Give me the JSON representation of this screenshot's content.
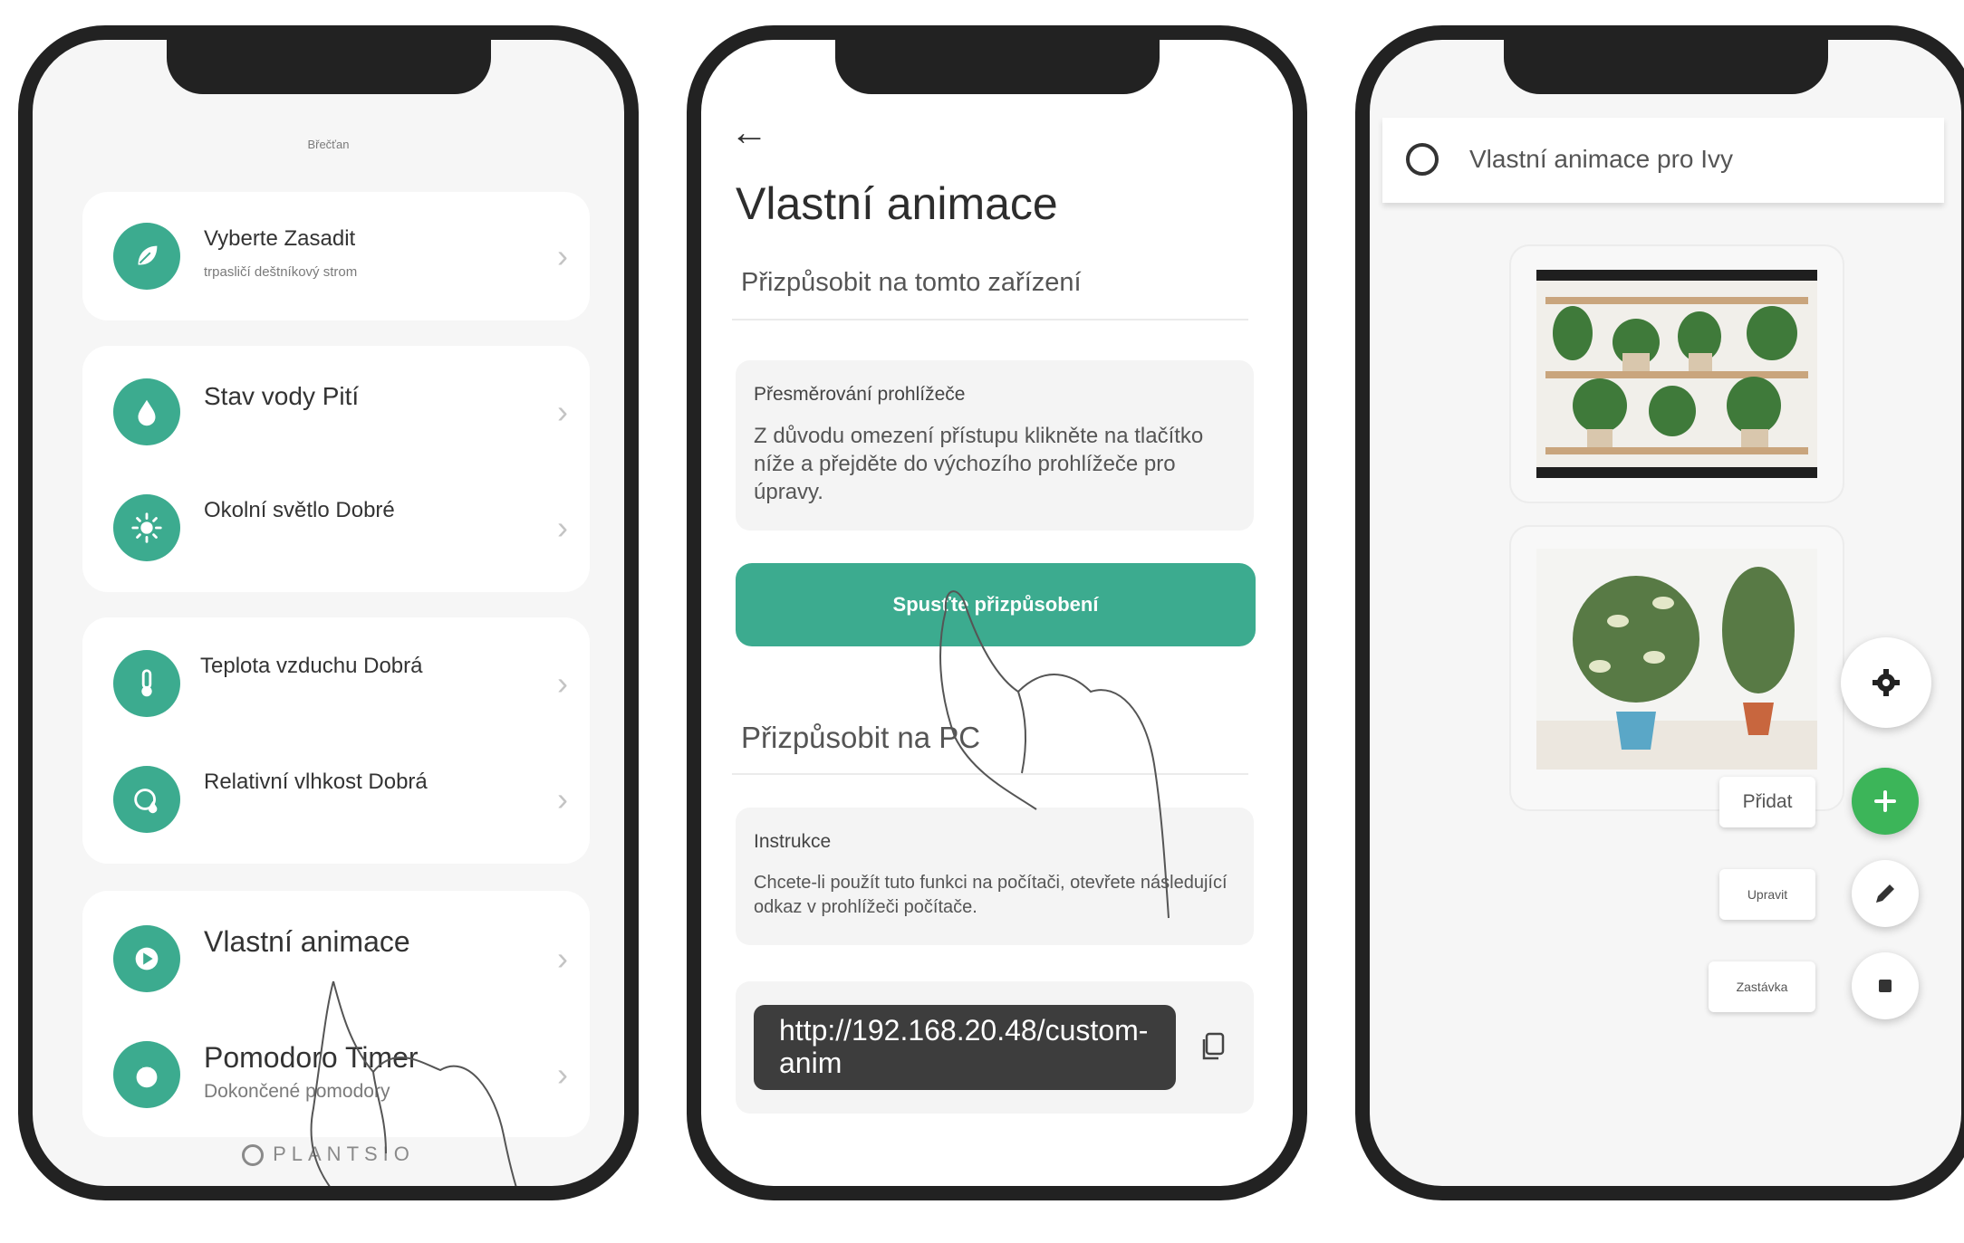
{
  "theme": {
    "accent": "#3cab8f",
    "fab_green": "#3cb559",
    "frame": "#222222",
    "url_pill": "#3d3d3d"
  },
  "phone1": {
    "header": "Břečťan",
    "items": [
      {
        "icon": "leaf-icon",
        "title": "Vyberte Zasadit",
        "subtitle": "trpasličí deštníkový strom"
      },
      {
        "icon": "water-drop-icon",
        "title": "Stav vody Pití",
        "subtitle": ""
      },
      {
        "icon": "sun-icon",
        "title": "Okolní světlo Dobré",
        "subtitle": ""
      },
      {
        "icon": "thermometer-icon",
        "title": "Teplota vzduchu Dobrá",
        "subtitle": ""
      },
      {
        "icon": "humidity-icon",
        "title": "Relativní vlhkost Dobrá",
        "subtitle": ""
      },
      {
        "icon": "play-icon",
        "title": "Vlastní animace",
        "subtitle": ""
      },
      {
        "icon": "tomato-icon",
        "title": "Pomodoro Timer",
        "subtitle": "Dokončené pomodory"
      }
    ],
    "chevron": "›",
    "brand": "PLANTSIO"
  },
  "phone2": {
    "back": "←",
    "title": "Vlastní animace",
    "section_device": "Přizpůsobit na tomto zařízení",
    "redirect_title": "Přesměrování prohlížeče",
    "redirect_text": "Z důvodu omezení přístupu klikněte na tlačítko níže a přejděte do výchozího prohlížeče pro úpravy.",
    "start_button": "Spusťte přizpůsobení",
    "section_pc": "Přizpůsobit na PC",
    "instructions_title": "Instrukce",
    "instructions_text": "Chcete-li použít tuto funkci na počítači, otevřete následující odkaz v prohlížeči počítače.",
    "url": "http://192.168.20.48/custom-anim"
  },
  "phone3": {
    "title": "Vlastní animace pro Ivy",
    "thumbnails": [
      {
        "name": "plant-shelf-image"
      },
      {
        "name": "potted-plants-image"
      }
    ],
    "actions": {
      "add_label": "Přidat",
      "edit_label": "Upravit",
      "stop_label": "Zastávka"
    }
  }
}
